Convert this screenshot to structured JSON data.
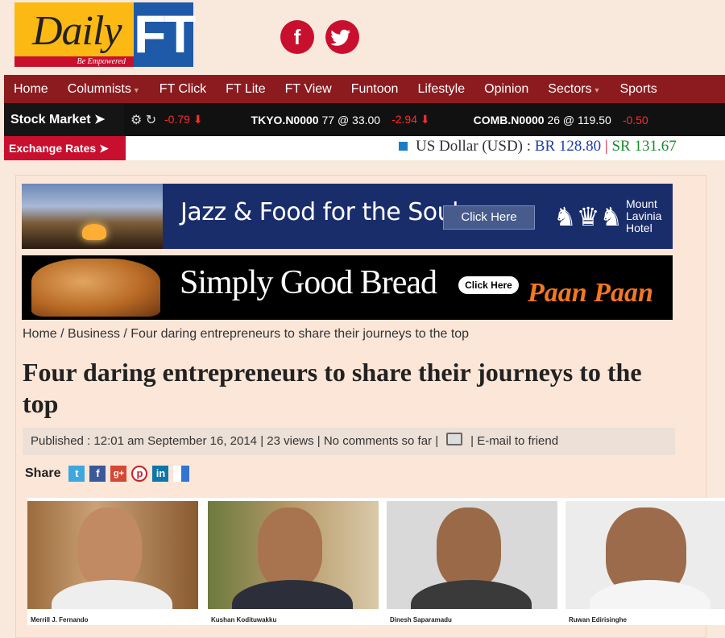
{
  "header": {
    "logo_daily": "Daily",
    "logo_ft": "FT",
    "logo_tagline": "Be Empowered",
    "facebook_icon": "f",
    "twitter_icon": "t"
  },
  "nav": {
    "items": [
      "Home",
      "Columnists",
      "FT Click",
      "FT Lite",
      "FT View",
      "Funtoon",
      "Lifestyle",
      "Opinion",
      "Sectors",
      "Sports"
    ]
  },
  "stock": {
    "label": "Stock Market",
    "first_change": "-0.79",
    "tickers": [
      {
        "symbol": "TKYO.N0000",
        "qty": "77",
        "price": "@ 33.00",
        "change": "-2.94"
      },
      {
        "symbol": "COMB.N0000",
        "qty": "26",
        "price": "@ 119.50",
        "change": "-0.50"
      }
    ]
  },
  "exchange": {
    "label": "Exchange Rates",
    "currency": "US Dollar (USD) :",
    "buy": "BR 128.80",
    "separator": "|",
    "sell": "SR 131.67"
  },
  "ads": {
    "ad1_text": "Jazz & Food for the Soul",
    "ad1_button": "Click Here",
    "ad1_brand": "Mount Lavinia Hotel",
    "ad2_text": "Simply Good Bread",
    "ad2_button": "Click Here",
    "ad2_brand": "Paan Paan"
  },
  "breadcrumb": "Home / Business / Four daring entrepreneurs to share their journeys to the top",
  "article": {
    "title": "Four daring entrepreneurs to share their journeys to the top",
    "published": "Published : 12:01 am  September 16, 2014  |  23 views  |  No comments so far  |",
    "email": "|  E-mail to friend"
  },
  "share": {
    "label": "Share",
    "icons": [
      "twitter-icon",
      "facebook-icon",
      "google-plus-icon",
      "pinterest-icon",
      "linkedin-icon",
      "delicious-icon"
    ]
  },
  "photos": [
    {
      "caption": "Merrill J. Fernando"
    },
    {
      "caption": "Kushan Kodituwakku"
    },
    {
      "caption": "Dinesh Saparamadu"
    },
    {
      "caption": "Ruwan Edirisinghe"
    }
  ],
  "colors": {
    "nav_bg": "#8c1b20",
    "accent_red": "#c8102e",
    "ft_blue": "#1e5aa8",
    "page_bg": "#f9e8dc"
  }
}
